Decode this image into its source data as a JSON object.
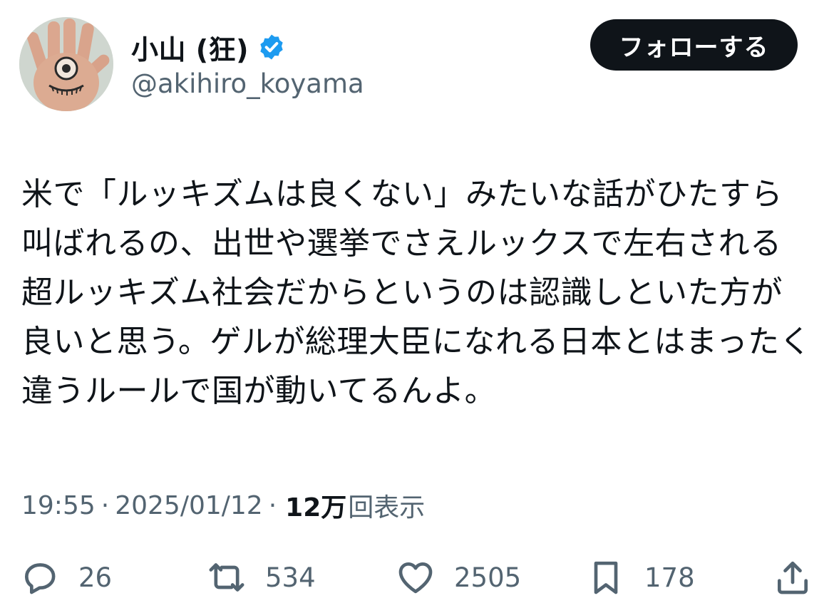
{
  "user": {
    "display_name": "小山 (狂)",
    "handle": "@akihiro_koyama",
    "verified": true,
    "avatar_icon": "hand-eye-avatar"
  },
  "follow_button": {
    "label": "フォローする"
  },
  "tweet": {
    "text": "米で「ルッキズムは良くない」みたいな話がひたすら叫ばれるの、出世や選挙でさえルックスで左右される超ルッキズム社会だからというのは認識しといた方が良いと思う。ゲルが総理大臣になれる日本とはまったく違うルールで国が動いてるんよ。"
  },
  "meta": {
    "time": "19:55",
    "separator": "·",
    "date": "2025/01/12",
    "views_count": "12万",
    "views_label": "回表示"
  },
  "actions": {
    "replies": "26",
    "retweets": "534",
    "likes": "2505",
    "bookmarks": "178"
  },
  "colors": {
    "text": "#0f1419",
    "secondary": "#536471",
    "verified": "#1d9bf0",
    "follow_bg": "#0f1419"
  }
}
